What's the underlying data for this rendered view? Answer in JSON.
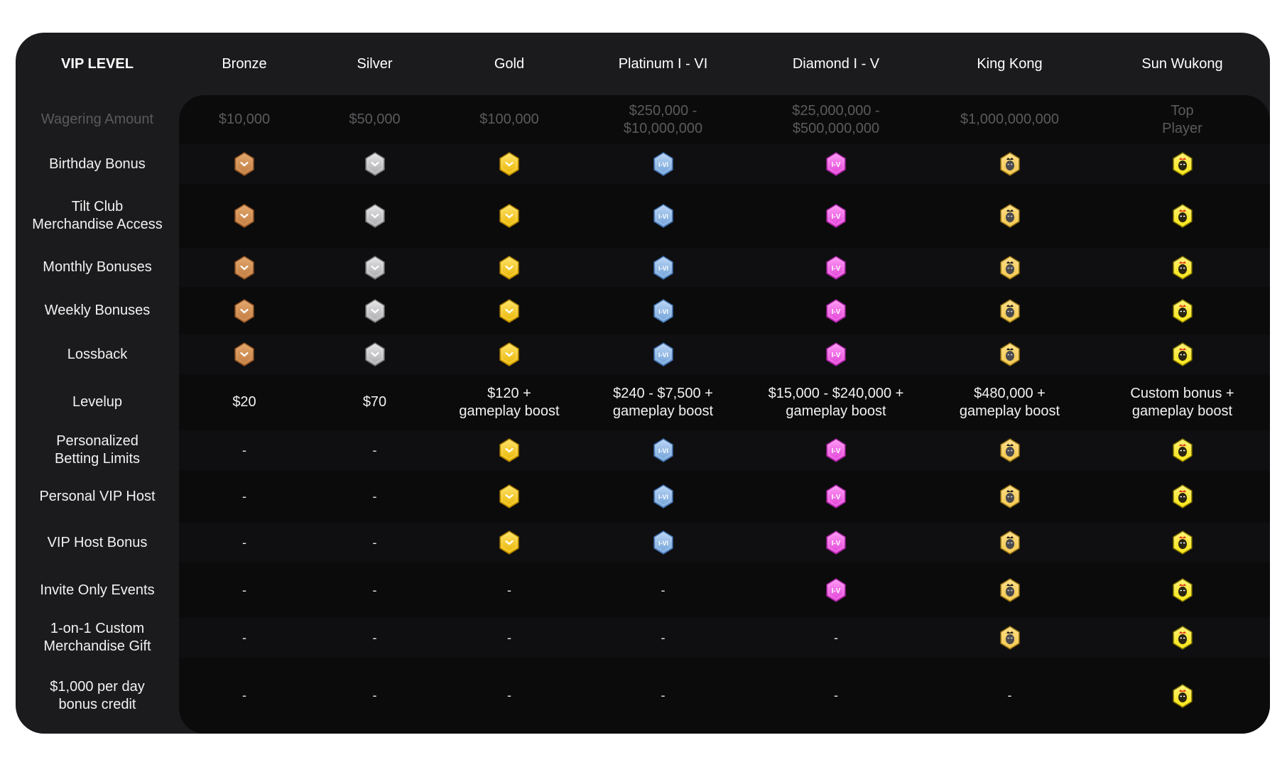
{
  "header": {
    "vip_level_label": "VIP LEVEL",
    "tiers": [
      "Bronze",
      "Silver",
      "Gold",
      "Platinum I - VI",
      "Diamond I - V",
      "King Kong",
      "Sun Wukong"
    ]
  },
  "tier_icons": [
    "bronze-badge-icon",
    "silver-badge-icon",
    "gold-badge-icon",
    "platinum-badge-icon",
    "diamond-badge-icon",
    "king-kong-badge-icon",
    "sun-wukong-badge-icon"
  ],
  "colors": {
    "bronze": "#c07a3f",
    "silver": "#a9a9ab",
    "gold": "#e8b400",
    "platinum": "#6ea0d8",
    "diamond": "#e03fd6",
    "king_kong": "#f0c243",
    "sun_wukong": "#f5e000"
  },
  "rows": [
    {
      "label": "Wagering Amount",
      "type": "wager",
      "values": [
        "$10,000",
        "$50,000",
        "$100,000",
        "$250,000 -\n$10,000,000",
        "$25,000,000 -\n$500,000,000",
        "$1,000,000,000",
        "Top\nPlayer"
      ]
    },
    {
      "label": "Birthday Bonus",
      "values": [
        "icon",
        "icon",
        "icon",
        "icon",
        "icon",
        "icon",
        "icon"
      ]
    },
    {
      "label": "Tilt Club\nMerchandise Access",
      "values": [
        "icon",
        "icon",
        "icon",
        "icon",
        "icon",
        "icon",
        "icon"
      ]
    },
    {
      "label": "Monthly Bonuses",
      "values": [
        "icon",
        "icon",
        "icon",
        "icon",
        "icon",
        "icon",
        "icon"
      ]
    },
    {
      "label": "Weekly Bonuses",
      "values": [
        "icon",
        "icon",
        "icon",
        "icon",
        "icon",
        "icon",
        "icon"
      ]
    },
    {
      "label": "Lossback",
      "values": [
        "icon",
        "icon",
        "icon",
        "icon",
        "icon",
        "icon",
        "icon"
      ]
    },
    {
      "label": "Levelup",
      "values": [
        "$20",
        "$70",
        "$120 +\ngameplay boost",
        "$240 - $7,500 +\ngameplay boost",
        "$15,000 - $240,000 +\ngameplay boost",
        "$480,000 +\ngameplay boost",
        "Custom bonus +\ngameplay boost"
      ]
    },
    {
      "label": "Personalized\nBetting Limits",
      "values": [
        "-",
        "-",
        "icon",
        "icon",
        "icon",
        "icon",
        "icon"
      ]
    },
    {
      "label": "Personal VIP Host",
      "values": [
        "-",
        "-",
        "icon",
        "icon",
        "icon",
        "icon",
        "icon"
      ]
    },
    {
      "label": "VIP Host Bonus",
      "values": [
        "-",
        "-",
        "icon",
        "icon",
        "icon",
        "icon",
        "icon"
      ]
    },
    {
      "label": "Invite Only Events",
      "values": [
        "-",
        "-",
        "-",
        "-",
        "icon",
        "icon",
        "icon"
      ]
    },
    {
      "label": "1-on-1 Custom\nMerchandise Gift",
      "values": [
        "-",
        "-",
        "-",
        "-",
        "-",
        "icon",
        "icon"
      ]
    },
    {
      "label": "$1,000 per day\n bonus credit",
      "values": [
        "-",
        "-",
        "-",
        "-",
        "-",
        "-",
        "icon"
      ]
    }
  ]
}
